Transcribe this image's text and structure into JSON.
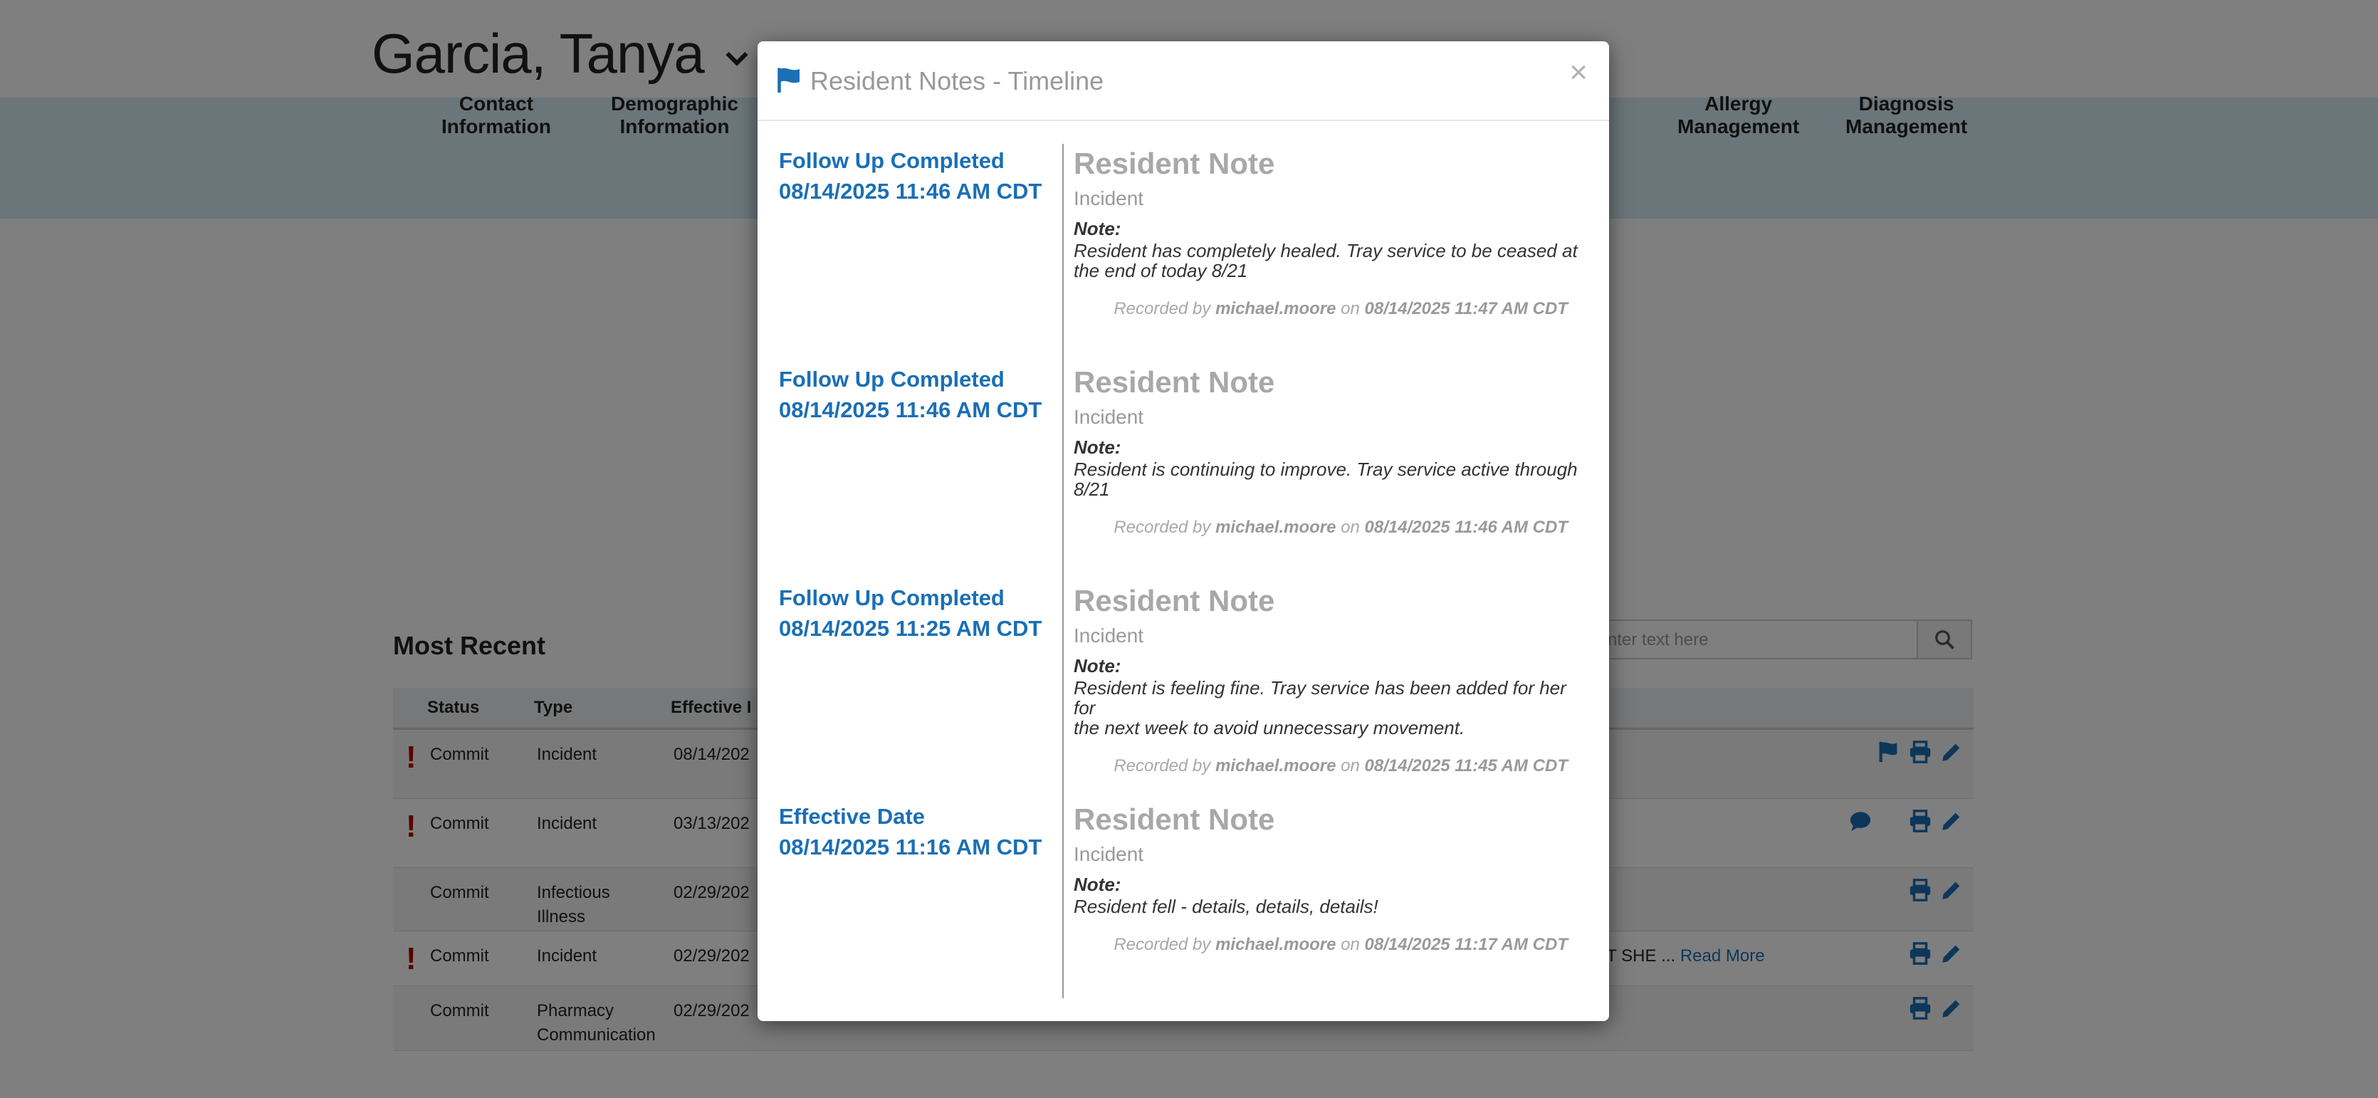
{
  "resident": {
    "name": "Garcia, Tanya"
  },
  "nav": {
    "items": [
      {
        "line1": "Contact",
        "line2": "Information"
      },
      {
        "line1": "Demographic",
        "line2": "Information"
      },
      {
        "line1": "Allergy",
        "line2": "Management"
      },
      {
        "line1": "Diagnosis",
        "line2": "Management"
      }
    ]
  },
  "section": {
    "title": "Most Recent"
  },
  "search": {
    "placeholder": "e, enter text here"
  },
  "table": {
    "headers": {
      "status": "Status",
      "type": "Type",
      "effective": "Effective I"
    },
    "rows": [
      {
        "alert": "!",
        "status": "Commit",
        "type1": "Incident",
        "type2": "",
        "date": "08/14/202",
        "extra": ""
      },
      {
        "alert": "!",
        "status": "Commit",
        "type1": "Incident",
        "type2": "",
        "date": "03/13/202",
        "extra": ""
      },
      {
        "alert": "",
        "status": "Commit",
        "type1": "Infectious",
        "type2": "Illness",
        "date": "02/29/202",
        "extra": ""
      },
      {
        "alert": "!",
        "status": "Commit",
        "type1": "Incident",
        "type2": "",
        "date": "02/29/202",
        "extra": "AT SHE ...",
        "read_more": "Read More"
      },
      {
        "alert": "",
        "status": "Commit",
        "type1": "Pharmacy",
        "type2": "Communication",
        "date": "02/29/202",
        "extra": ""
      }
    ]
  },
  "modal": {
    "title": "Resident Notes - Timeline",
    "close": "×",
    "entries": [
      {
        "event": "Follow Up Completed",
        "datetime": "08/14/2025 11:46 AM CDT",
        "heading": "Resident Note",
        "type": "Incident",
        "note_label": "Note:",
        "note_line1": "Resident has completely healed.  Tray service to be ceased at",
        "note_line2": "the end of today 8/21",
        "recorded_prefix": "Recorded by",
        "recorded_user": "michael.moore",
        "recorded_on": "on",
        "recorded_time": "08/14/2025 11:47 AM CDT"
      },
      {
        "event": "Follow Up Completed",
        "datetime": "08/14/2025 11:46 AM CDT",
        "heading": "Resident Note",
        "type": "Incident",
        "note_label": "Note:",
        "note_line1": "Resident is continuing to improve.  Tray service active through",
        "note_line2": "8/21",
        "recorded_prefix": "Recorded by",
        "recorded_user": "michael.moore",
        "recorded_on": "on",
        "recorded_time": "08/14/2025 11:46 AM CDT"
      },
      {
        "event": "Follow Up Completed",
        "datetime": "08/14/2025 11:25 AM CDT",
        "heading": "Resident Note",
        "type": "Incident",
        "note_label": "Note:",
        "note_line1": "Resident is feeling fine.  Tray service has been added for her for",
        "note_line2": "the next week to avoid unnecessary movement.",
        "recorded_prefix": "Recorded by",
        "recorded_user": "michael.moore",
        "recorded_on": "on",
        "recorded_time": "08/14/2025 11:45 AM CDT"
      },
      {
        "event": "Effective Date",
        "datetime": "08/14/2025 11:16 AM CDT",
        "heading": "Resident Note",
        "type": "Incident",
        "note_label": "Note:",
        "note_line1": "Resident fell - details, details, details!",
        "note_line2": "",
        "recorded_prefix": "Recorded by",
        "recorded_user": "michael.moore",
        "recorded_on": "on",
        "recorded_time": "08/14/2025 11:17 AM CDT"
      }
    ]
  },
  "colors": {
    "link_blue": "#1a6fb5",
    "alert_red": "#b30000",
    "nav_band": "#d7ecf7"
  }
}
